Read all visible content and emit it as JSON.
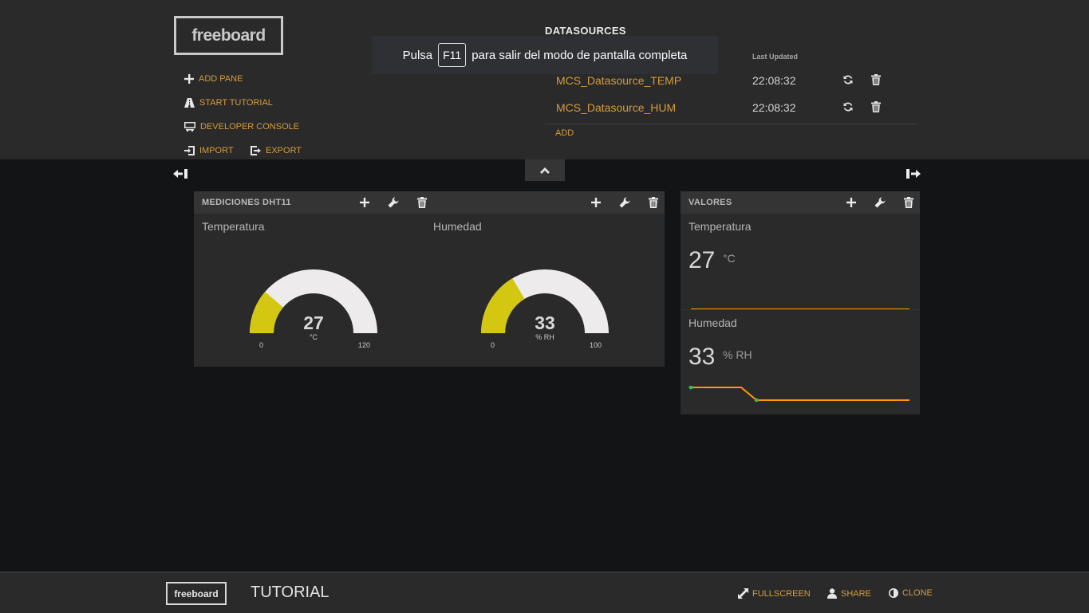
{
  "header": {
    "logo": "freeboard",
    "menu": {
      "add_pane": "ADD PANE",
      "start_tutorial": "START TUTORIAL",
      "developer_console": "DEVELOPER CONSOLE",
      "import": "IMPORT",
      "export": "EXPORT"
    },
    "datasources": {
      "title": "DATASOURCES",
      "col_last_updated": "Last Updated",
      "rows": [
        {
          "name": "MCS_Datasource_TEMP",
          "updated": "22:08:32"
        },
        {
          "name": "MCS_Datasource_HUM",
          "updated": "22:08:32"
        }
      ],
      "add": "ADD"
    }
  },
  "toast": {
    "pre": "Pulsa",
    "key": "F11",
    "post": "para salir del modo de pantalla completa"
  },
  "panes": [
    {
      "title": "MEDICIONES DHT11",
      "widgets": [
        {
          "title": "Temperatura",
          "value": "27",
          "units": "°C",
          "min": "0",
          "max": "120",
          "fraction": 0.225,
          "color": "#d4c712"
        },
        {
          "title": "Humedad",
          "value": "33",
          "units": "% RH",
          "min": "0",
          "max": "100",
          "fraction": 0.33,
          "color": "#d4c712"
        }
      ]
    },
    {
      "title": "VALORES",
      "widgets": [
        {
          "title": "Temperatura",
          "value": "27",
          "units": "°C",
          "sparkline": [
            27,
            27
          ],
          "line_color": "#ff9900"
        },
        {
          "title": "Humedad",
          "value": "33",
          "units": "% RH",
          "sparkline": [
            34,
            34,
            33,
            33
          ],
          "line_color": "#ff9900",
          "point_color": "#4caf50"
        }
      ]
    }
  ],
  "footer": {
    "logo": "freeboard",
    "title": "TUTORIAL",
    "fullscreen": "FULLSCREEN",
    "share": "SHARE",
    "clone": "CLONE"
  },
  "icons": [
    "plus-icon",
    "road-icon",
    "monitor-icon",
    "import-icon",
    "export-icon",
    "refresh-icon",
    "trash-icon",
    "wrench-icon",
    "chevron-up-icon",
    "collapse-left-icon",
    "expand-right-icon",
    "resize-icon",
    "user-icon",
    "contrast-icon"
  ],
  "colors": {
    "accent": "#d59b3e",
    "gauge_fill": "#d4c712",
    "sparkline": "#ff9900"
  }
}
